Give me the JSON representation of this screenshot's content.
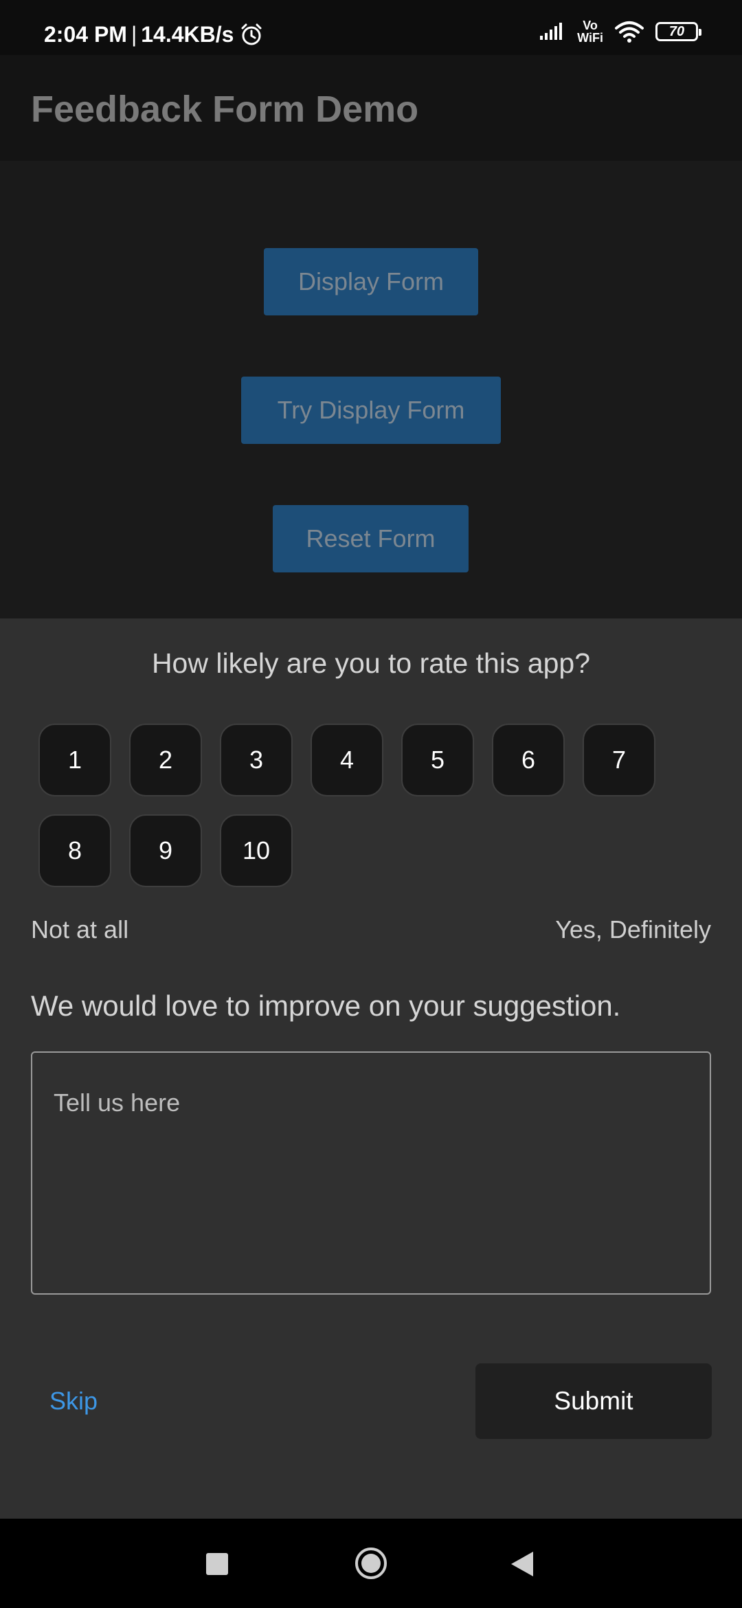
{
  "status_bar": {
    "time": "2:04 PM",
    "separator": "|",
    "network_speed": "14.4KB/s",
    "alarm_icon": "alarm-clock-icon",
    "vowifi_top": "Vo",
    "vowifi_bottom": "WiFi",
    "battery_level": "70"
  },
  "app_bar": {
    "title": "Feedback Form Demo"
  },
  "content": {
    "buttons": [
      {
        "label": "Display Form"
      },
      {
        "label": "Try Display Form"
      },
      {
        "label": "Reset Form"
      }
    ],
    "accent_color": "#1d4e78"
  },
  "feedback_sheet": {
    "question": "How likely are you to rate this app?",
    "ratings": [
      "1",
      "2",
      "3",
      "4",
      "5",
      "6",
      "7",
      "8",
      "9",
      "10"
    ],
    "low_label": "Not at all",
    "high_label": "Yes, Definitely",
    "suggestion_prompt": "We would love to improve on your suggestion.",
    "input": {
      "placeholder": "Tell us here",
      "value": ""
    },
    "skip_label": "Skip",
    "submit_label": "Submit",
    "skip_color": "#3d97e6"
  },
  "nav_bar": {
    "icons": [
      "recent-apps-icon",
      "home-icon",
      "back-icon"
    ]
  }
}
